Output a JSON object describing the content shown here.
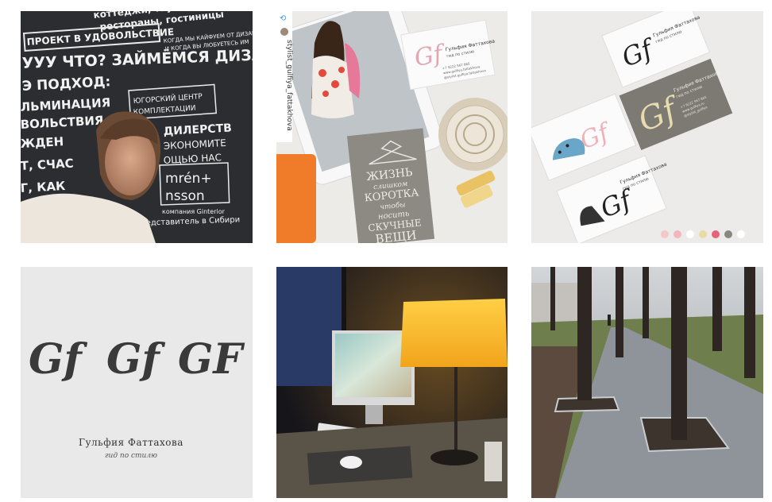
{
  "gallery": {
    "tiles": [
      {
        "lines": [
          "коттеджи, таунхаусы,",
          "рестораны, гостиницы",
          "ПРОЕКТ В УДОВОЛЬСТВИЕ",
          "КОГДА МЫ КАЙФУЕМ ОТ ДИЗАЙНА",
          "И КОГДА ВЫ ЛЮБУЕТЕСЬ ИМ",
          "УУУ ЧТО? ЗАЙМЁМСЯ ДИЗАЙ",
          "Э ПОДХОД:",
          "ЮГОРСКИЙ ЦЕНТР",
          "КОМПЛЕКТАЦИИ",
          "ЛЬМИНАЦИЯ",
          "ВОЛЬСТВИЯ",
          "ДИЛЕРСТВ",
          "ЭКОНОМИТЕ",
          "ОЩЬЮ НАС",
          "ЖДЕН",
          "Т, СЧАС",
          "Г, КАК",
          "mrén+",
          "nsson",
          "компания Ginterior",
          "представитель в Сибири"
        ]
      },
      {
        "username": "stylist_gulfiya_fattakhova",
        "card_name": "Гульфия Фаттахова",
        "card_role": "гид по стилю",
        "card_phone": "+7 9222 567 865",
        "card_site": "www.gulfiya.fattakhova",
        "card_handle": "@stylist.gulfiya.fattakhova",
        "book_lines": [
          "ЖИЗНЬ",
          "слишком",
          "КОРОТКА",
          "чтобы",
          "носить",
          "СКУЧНЫЕ",
          "ВЕЩИ"
        ]
      },
      {
        "card_name": "Гульфия Фаттахова",
        "card_role": "гид по стилю",
        "card_phone": "+7 9222 567 865",
        "card_site": "www.gulfiya.ru",
        "card_handle": "@stylist_gulfiya",
        "palette": [
          "#f5c8c8",
          "#f2b6bc",
          "#ffffff",
          "#e8dca6",
          "#e8617a",
          "#8a8680",
          "#ffffff"
        ]
      },
      {
        "logos": [
          "Gf",
          "Gf",
          "GF"
        ],
        "name": "Гульфия Фаттахова",
        "role": "гид по стилю"
      },
      {},
      {}
    ]
  }
}
